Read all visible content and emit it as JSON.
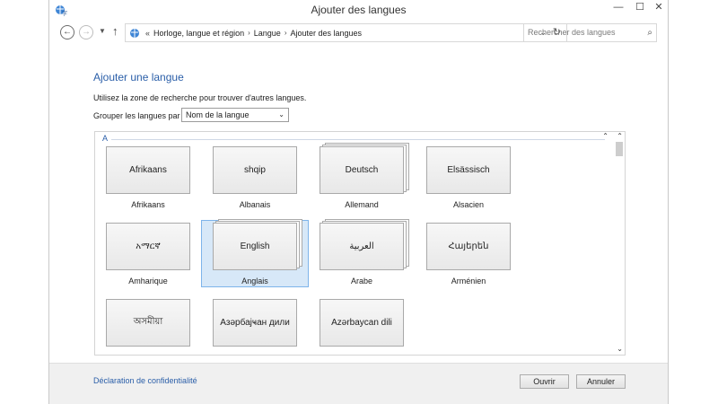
{
  "window": {
    "title": "Ajouter des langues",
    "min_icon": "minimize-icon",
    "max_icon": "maximize-icon",
    "close_icon": "close-icon"
  },
  "address": {
    "overflow": "«",
    "crumbs": [
      "Horloge, langue et région",
      "Langue",
      "Ajouter des langues"
    ],
    "search_placeholder": "Rechercher des langues"
  },
  "main": {
    "title": "Ajouter une langue",
    "hint": "Utilisez la zone de recherche pour trouver d'autres langues.",
    "group_label": "Grouper les langues par :",
    "group_value": "Nom de la langue",
    "section_letter": "A",
    "tiles": [
      {
        "native": "Afrikaans",
        "caption": "Afrikaans",
        "stack": false,
        "selected": false
      },
      {
        "native": "shqip",
        "caption": "Albanais",
        "stack": false,
        "selected": false
      },
      {
        "native": "Deutsch",
        "caption": "Allemand",
        "stack": true,
        "selected": false
      },
      {
        "native": "Elsässisch",
        "caption": "Alsacien",
        "stack": false,
        "selected": false
      },
      {
        "native": "አማርኛ",
        "caption": "Amharique",
        "stack": false,
        "selected": false
      },
      {
        "native": "English",
        "caption": "Anglais",
        "stack": true,
        "selected": true
      },
      {
        "native": "العربية",
        "caption": "Arabe",
        "stack": true,
        "selected": false
      },
      {
        "native": "Հայերեն",
        "caption": "Arménien",
        "stack": false,
        "selected": false
      },
      {
        "native": "অসমীয়া",
        "caption": "",
        "stack": false,
        "selected": false
      },
      {
        "native": "Азәрбајҹан дили",
        "caption": "",
        "stack": false,
        "selected": false
      },
      {
        "native": "Azərbaycan dili",
        "caption": "",
        "stack": false,
        "selected": false
      }
    ]
  },
  "footer": {
    "privacy": "Déclaration de confidentialité",
    "open": "Ouvrir",
    "cancel": "Annuler"
  },
  "colors": {
    "accent": "#2a5ea8",
    "selection": "#d7e8f8",
    "selection_border": "#7eb4ea"
  }
}
